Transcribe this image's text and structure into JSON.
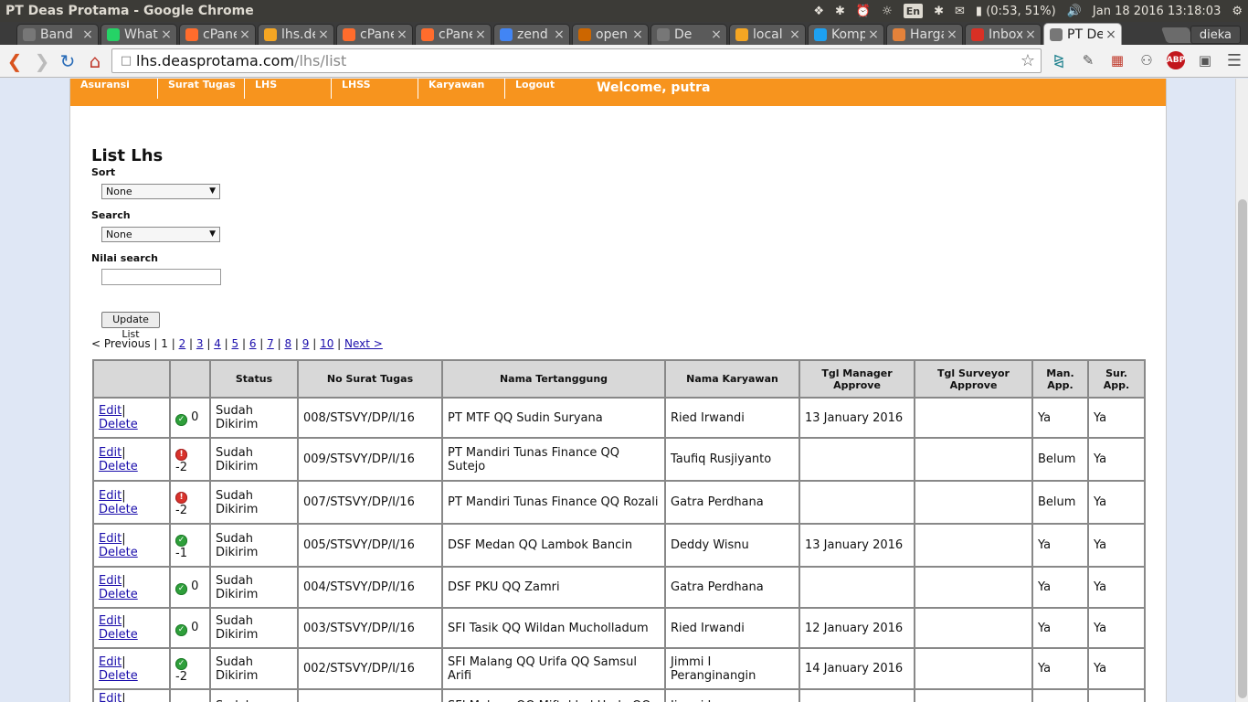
{
  "os": {
    "window_title": "PT Deas Protama - Google Chrome",
    "lang": "En",
    "battery": "(0:53, 51%)",
    "datetime": "Jan 18 2016 13:18:03"
  },
  "tabs": [
    {
      "label": "Band",
      "icon": "page-icon",
      "color": "#777777"
    },
    {
      "label": "What",
      "icon": "whatsapp-icon",
      "color": "#25d366"
    },
    {
      "label": "cPanel",
      "icon": "cpanel-icon",
      "color": "#ff6c2c"
    },
    {
      "label": "lhs.de",
      "icon": "pma-icon",
      "color": "#f5a623"
    },
    {
      "label": "cPanel",
      "icon": "cpanel-icon",
      "color": "#ff6c2c"
    },
    {
      "label": "cPanel",
      "icon": "cpanel-icon",
      "color": "#ff6c2c"
    },
    {
      "label": "zend",
      "icon": "google-icon",
      "color": "#4285f4"
    },
    {
      "label": "open",
      "icon": "openshift-icon",
      "color": "#cc6600"
    },
    {
      "label": "De",
      "icon": "page-icon",
      "color": "#777777"
    },
    {
      "label": "local",
      "icon": "pma-icon",
      "color": "#f5a623"
    },
    {
      "label": "Komp",
      "icon": "twitter-icon",
      "color": "#1da1f2"
    },
    {
      "label": "Harga",
      "icon": "tag-icon",
      "color": "#e4823a"
    },
    {
      "label": "Inbox",
      "icon": "gmail-icon",
      "color": "#d93025"
    },
    {
      "label": "PT De",
      "icon": "page-icon",
      "color": "#777777",
      "active": true
    }
  ],
  "profile": "dieka",
  "url": {
    "host": "lhs.deasprotama.com",
    "path": "/lhs/list"
  },
  "nav": {
    "items": [
      "Asuransi",
      "Surat Tugas",
      "LHS",
      "LHSS",
      "Karyawan",
      "Logout"
    ],
    "welcome": "Welcome, putra"
  },
  "page": {
    "title": "List Lhs",
    "sort_label": "Sort",
    "sort_value": "None",
    "search_label": "Search",
    "search_value": "None",
    "nilai_label": "Nilai search",
    "nilai_value": "",
    "update_button": "Update List"
  },
  "pager": {
    "previous": "< Previous",
    "current": "1",
    "pages": [
      "2",
      "3",
      "4",
      "5",
      "6",
      "7",
      "8",
      "9",
      "10"
    ],
    "next": "Next >"
  },
  "table": {
    "headers": [
      "",
      "",
      "Status",
      "No Surat Tugas",
      "Nama Tertanggung",
      "Nama Karyawan",
      "Tgl Manager Approve",
      "Tgl Surveyor Approve",
      "Man. App.",
      "Sur. App."
    ],
    "edit_label": "Edit",
    "delete_label": "Delete",
    "rows": [
      {
        "icon": "ok",
        "num": "0",
        "status": "Sudah Dikirim",
        "no": "008/STSVY/DP/I/16",
        "tertanggung": "PT MTF QQ Sudin Suryana",
        "karyawan": "Ried Irwandi",
        "tgl_man": "13 January 2016",
        "tgl_sur": "",
        "man": "Ya",
        "sur": "Ya"
      },
      {
        "icon": "warn",
        "num": "-2",
        "status": "Sudah Dikirim",
        "no": "009/STSVY/DP/I/16",
        "tertanggung": "PT Mandiri Tunas Finance QQ Sutejo",
        "karyawan": "Taufiq Rusjiyanto",
        "tgl_man": "",
        "tgl_sur": "",
        "man": "Belum",
        "sur": "Ya"
      },
      {
        "icon": "warn",
        "num": "-2",
        "status": "Sudah Dikirim",
        "no": "007/STSVY/DP/I/16",
        "tertanggung": "PT Mandiri Tunas Finance QQ Rozali",
        "karyawan": "Gatra Perdhana",
        "tgl_man": "",
        "tgl_sur": "",
        "man": "Belum",
        "sur": "Ya"
      },
      {
        "icon": "ok",
        "num": "-1",
        "status": "Sudah Dikirim",
        "no": "005/STSVY/DP/I/16",
        "tertanggung": "DSF Medan QQ Lambok Bancin",
        "karyawan": "Deddy Wisnu",
        "tgl_man": "13 January 2016",
        "tgl_sur": "",
        "man": "Ya",
        "sur": "Ya"
      },
      {
        "icon": "ok",
        "num": "0",
        "status": "Sudah Dikirim",
        "no": "004/STSVY/DP/I/16",
        "tertanggung": "DSF PKU QQ Zamri",
        "karyawan": "Gatra Perdhana",
        "tgl_man": "",
        "tgl_sur": "",
        "man": "Ya",
        "sur": "Ya"
      },
      {
        "icon": "ok",
        "num": "0",
        "status": "Sudah Dikirim",
        "no": "003/STSVY/DP/I/16",
        "tertanggung": "SFI Tasik QQ Wildan Mucholladum",
        "karyawan": "Ried Irwandi",
        "tgl_man": "12 January 2016",
        "tgl_sur": "",
        "man": "Ya",
        "sur": "Ya"
      },
      {
        "icon": "ok",
        "num": "-2",
        "status": "Sudah Dikirim",
        "no": "002/STSVY/DP/I/16",
        "tertanggung": "SFI Malang QQ Urifa QQ Samsul Arifi",
        "karyawan": "Jimmi I Peranginangin",
        "tgl_man": "14 January 2016",
        "tgl_sur": "",
        "man": "Ya",
        "sur": "Ya"
      },
      {
        "icon": "ok",
        "num": "",
        "status": "Sudah",
        "no": "",
        "tertanggung": "SFI Malang QQ Miftakhul Huda QQ",
        "karyawan": "Jimmi I",
        "tgl_man": "",
        "tgl_sur": "",
        "man": "",
        "sur": ""
      }
    ]
  }
}
